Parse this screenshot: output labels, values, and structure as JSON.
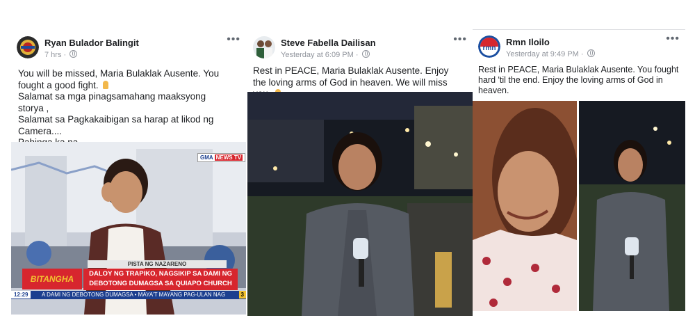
{
  "posts": [
    {
      "author": "Ryan Bulador Balingit",
      "time": "7 hrs",
      "text_lines": [
        "You will be missed, Maria Bulaklak Ausente. You fought a good fight.",
        "Salamat sa mga pinagsamahang maaksyong storya ,",
        "Salamat sa Pagkakaibigan sa harap at likod ng Camera....",
        "Pahinga ka na..."
      ],
      "image": {
        "tv_logo": "NEWS TV",
        "tv_network": "GMA",
        "program": "BITANGHA",
        "kicker": "PISTA NG NAZARENO",
        "headline_1": "DALOY NG TRAPIKO, NAGSIKIP SA DAMI NG",
        "headline_2": "DEBOTONG DUMAGSA SA QUIAPO CHURCH",
        "clock": "12:29",
        "ticker": "A DAMI NG DEBOTONG DUMAGSA  •  MAYA'T MAYANG PAG-ULAN NAG",
        "channel": "3"
      }
    },
    {
      "author": "Steve Fabella Dailisan",
      "time": "Yesterday at 6:09 PM",
      "text_lines": [
        "Rest in PEACE, Maria Bulaklak Ausente. Enjoy the loving arms of God in heaven. We will miss you."
      ]
    },
    {
      "author": "Rmn Iloilo",
      "avatar_text": "rmn",
      "time": "Yesterday at 9:49 PM",
      "text_lines": [
        "Rest in PEACE, Maria Bulaklak Ausente. You fought hard 'til the end. Enjoy the loving arms of God in heaven."
      ]
    }
  ],
  "ui": {
    "more_label": "•••",
    "dot": "·",
    "emoji_name": "folded-hands"
  },
  "colors": {
    "name": "#1c1e21",
    "meta": "#90949c",
    "lower_third_red": "#d7262e",
    "lower_third_blue": "#1c3f8f"
  }
}
